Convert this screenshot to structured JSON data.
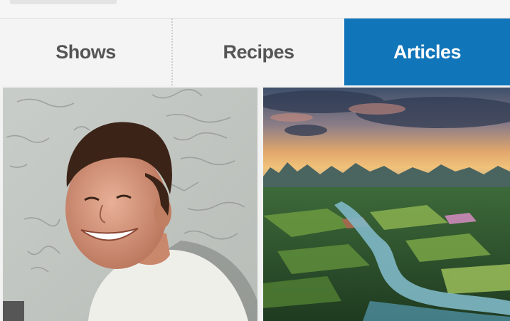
{
  "tabs": [
    {
      "label": "Shows",
      "active": false
    },
    {
      "label": "Recipes",
      "active": false
    },
    {
      "label": "Articles",
      "active": true
    }
  ],
  "colors": {
    "active_tab": "#1175ba",
    "inactive_tab_text": "#555555",
    "tab_bar_bg": "#f4f4f4"
  },
  "thumbnails": [
    {
      "icon": "portrait-photo",
      "subject": "smiling man in front of whiteboard"
    },
    {
      "icon": "landscape-photo",
      "subject": "river valley with karst mountains at sunset"
    }
  ]
}
